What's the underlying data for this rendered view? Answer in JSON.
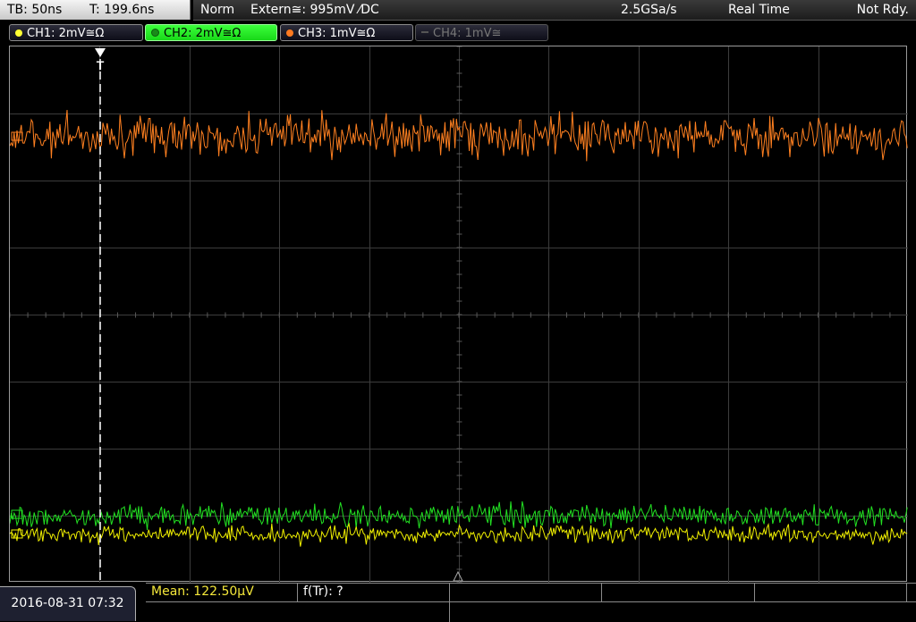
{
  "header": {
    "timebase": "TB: 50ns",
    "trigger_time": "T: 199.6ns",
    "mode": "Norm",
    "trigger_source": "Extern≅: 995mV ⁄DC",
    "sample_rate": "2.5GSa/s",
    "acquisition_mode": "Real Time",
    "status": "Not Rdy."
  },
  "channels": [
    {
      "label": "CH1: 2mV≅Ω",
      "color": "#ffff33",
      "active": false,
      "enabled": true
    },
    {
      "label": "CH2: 2mV≅Ω",
      "color": "#33ff33",
      "active": true,
      "enabled": true
    },
    {
      "label": "CH3: 1mV≅Ω",
      "color": "#ff7a20",
      "active": false,
      "enabled": true
    },
    {
      "label": "CH4: 1mV≅",
      "color": "#777777",
      "active": false,
      "enabled": false
    }
  ],
  "trigger_marker": "T",
  "waveform_colors": {
    "ch1": "#f0f000",
    "ch2": "#22e022",
    "ch3": "#ff8020",
    "grid": "#3c3c3c",
    "trigger_line": "#ffffff"
  },
  "footer": {
    "datetime": "2016-08-31 07:32",
    "mean": "Mean: 122.50µV",
    "f_tr": "f(Tr): ?"
  }
}
